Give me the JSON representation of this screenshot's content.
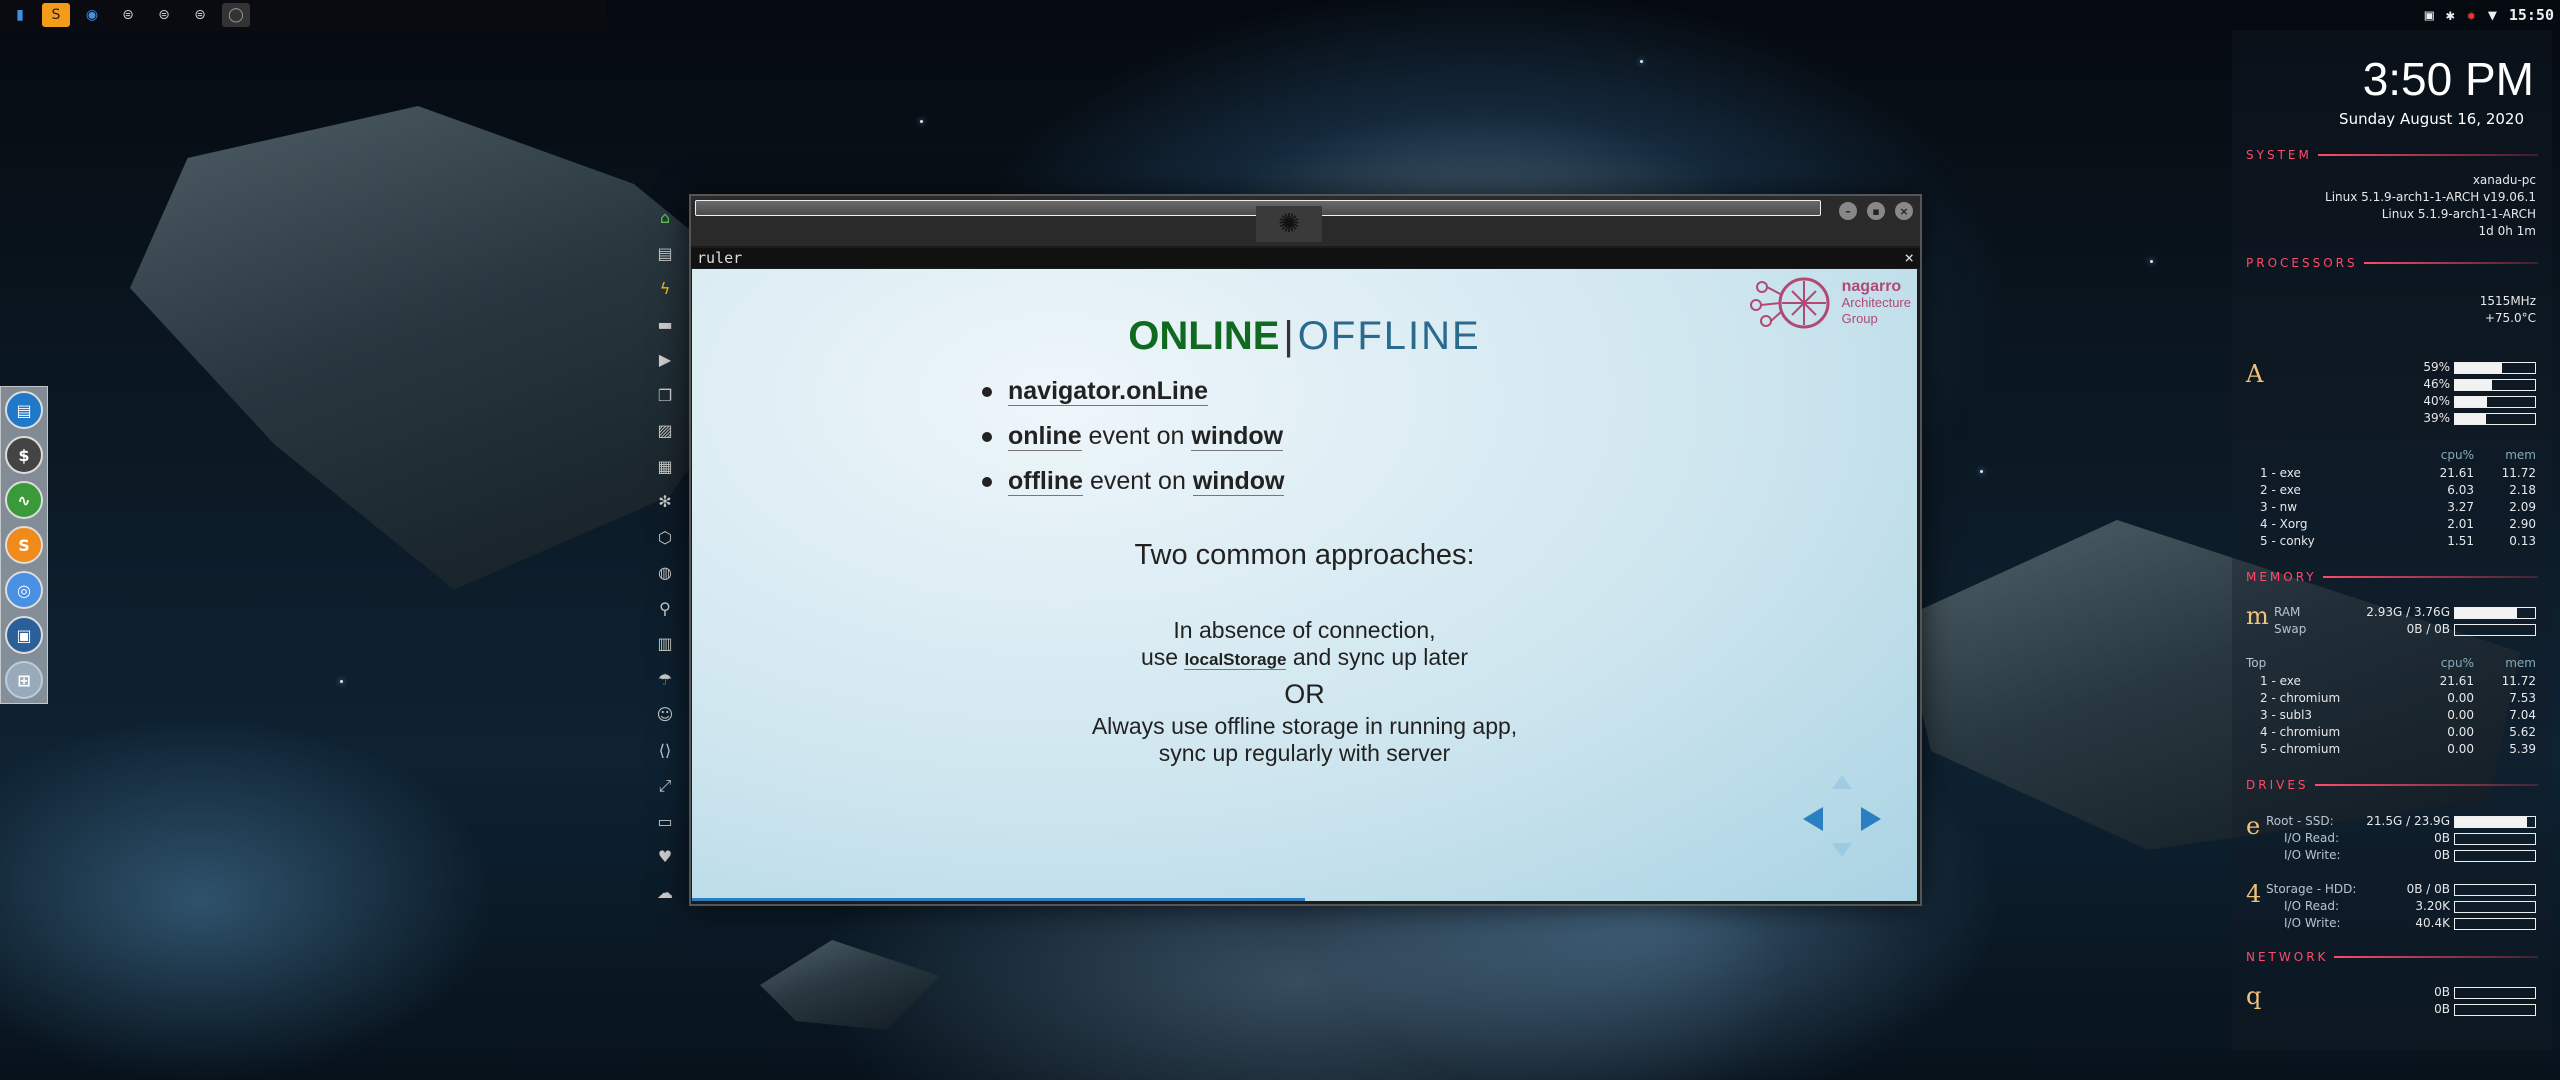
{
  "tray": {
    "clock": "15:50"
  },
  "slide": {
    "heading_online": "ONLINE",
    "heading_sep": "|",
    "heading_offline": "OFFLINE",
    "brand": {
      "name": "nagarro",
      "line2": "Architecture",
      "line3": "Group"
    },
    "bullets": [
      {
        "code": "navigator.onLine",
        "text": "",
        "code2": ""
      },
      {
        "code": "online",
        "text": " event on ",
        "code2": "window"
      },
      {
        "code": "offline",
        "text": " event on ",
        "code2": "window"
      }
    ],
    "approaches_title": "Two common approaches:",
    "approach1_line1": "In absence of connection,",
    "approach1_use": "use ",
    "approach1_code": "localStorage",
    "approach1_rest": " and sync up later",
    "or_label": "OR",
    "approach2_line1": "Always use offline storage in running app,",
    "approach2_line2": "sync up regularly with server",
    "progress": 0.5
  },
  "window": {
    "tab_title": "ruler",
    "tab_close": "×"
  },
  "conky": {
    "time": "3:50 PM",
    "date": "Sunday August 16, 2020",
    "system": {
      "title": "SYSTEM",
      "hostname": "xanadu-pc",
      "kernel": "Linux 5.1.9-arch1-1-ARCH v19.06.1",
      "kernel2": "Linux 5.1.9-arch1-1-ARCH",
      "uptime": "1d 0h 1m"
    },
    "processors": {
      "title": "PROCESSORS",
      "freq": "1515MHz",
      "temp": "+75.0°C",
      "letter": "A",
      "cores": [
        59,
        46,
        40,
        39
      ],
      "core_labels": [
        "59%",
        "46%",
        "40%",
        "39%"
      ],
      "col_cpu": "cpu%",
      "col_mem": "mem",
      "top": [
        {
          "name": "1 - exe",
          "cpu": "21.61",
          "mem": "11.72"
        },
        {
          "name": "2 - exe",
          "cpu": "6.03",
          "mem": "2.18"
        },
        {
          "name": "3 - nw",
          "cpu": "3.27",
          "mem": "2.09"
        },
        {
          "name": "4 - Xorg",
          "cpu": "2.01",
          "mem": "2.90"
        },
        {
          "name": "5 - conky",
          "cpu": "1.51",
          "mem": "0.13"
        }
      ]
    },
    "memory": {
      "title": "MEMORY",
      "letter": "m",
      "ram_label": "RAM",
      "ram": "2.93G / 3.76G",
      "ram_pct": 78,
      "swap_label": "Swap",
      "swap": "0B / 0B",
      "swap_pct": 0,
      "top_label": "Top",
      "col_cpu": "cpu%",
      "col_mem": "mem",
      "top": [
        {
          "name": "1 - exe",
          "cpu": "21.61",
          "mem": "11.72"
        },
        {
          "name": "2 - chromium",
          "cpu": "0.00",
          "mem": "7.53"
        },
        {
          "name": "3 - subl3",
          "cpu": "0.00",
          "mem": "7.04"
        },
        {
          "name": "4 - chromium",
          "cpu": "0.00",
          "mem": "5.62"
        },
        {
          "name": "5 - chromium",
          "cpu": "0.00",
          "mem": "5.39"
        }
      ]
    },
    "drives": {
      "title": "DRIVES",
      "letter1": "e",
      "root_label": "Root - SSD:",
      "root": "21.5G / 23.9G",
      "root_pct": 90,
      "root_read_label": "I/O Read:",
      "root_read": "0B",
      "root_write_label": "I/O Write:",
      "root_write": "0B",
      "letter2": "4",
      "storage_label": "Storage - HDD:",
      "storage": "0B / 0B",
      "storage_pct": 0,
      "st_read_label": "I/O Read:",
      "st_read": "3.20K",
      "st_write_label": "I/O Write:",
      "st_write": "40.4K"
    },
    "network": {
      "title": "NETWORK",
      "letter": "q",
      "down": "0B",
      "up": "0B"
    }
  }
}
